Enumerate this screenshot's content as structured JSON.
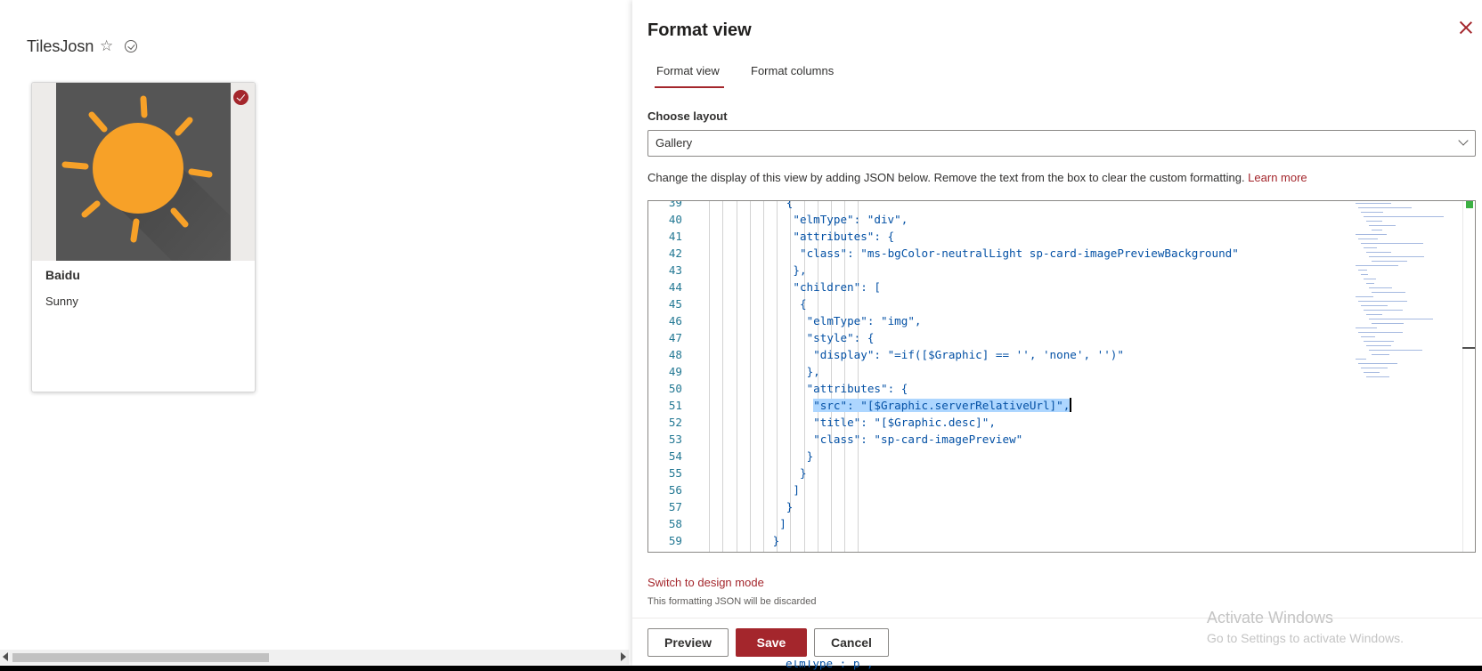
{
  "list": {
    "title": "TilesJosn",
    "star_glyph": "☆",
    "card": {
      "title": "Baidu",
      "subtitle": "Sunny",
      "check_color": "#a4262c"
    }
  },
  "panel": {
    "title": "Format view",
    "tabs": [
      {
        "label": "Format view",
        "selected": true
      },
      {
        "label": "Format columns",
        "selected": false
      }
    ],
    "layout_label": "Choose layout",
    "layout_value": "Gallery",
    "description": "Change the display of this view by adding JSON below. Remove the text from the box to clear the custom formatting. ",
    "learn_more": "Learn more",
    "switch_link": "Switch to design mode",
    "discard_note": "This formatting JSON will be discarded",
    "buttons": {
      "preview": "Preview",
      "save": "Save",
      "cancel": "Cancel"
    },
    "accent_color": "#a4262c"
  },
  "editor": {
    "lines": [
      {
        "no": "39",
        "indent": 13,
        "code": "{"
      },
      {
        "no": "40",
        "indent": 14,
        "code": "\"elmType\": \"div\","
      },
      {
        "no": "41",
        "indent": 14,
        "code": "\"attributes\": {"
      },
      {
        "no": "42",
        "indent": 15,
        "code": "\"class\": \"ms-bgColor-neutralLight sp-card-imagePreviewBackground\""
      },
      {
        "no": "43",
        "indent": 14,
        "code": "},"
      },
      {
        "no": "44",
        "indent": 14,
        "code": "\"children\": ["
      },
      {
        "no": "45",
        "indent": 15,
        "code": "{"
      },
      {
        "no": "46",
        "indent": 16,
        "code": "\"elmType\": \"img\","
      },
      {
        "no": "47",
        "indent": 16,
        "code": "\"style\": {"
      },
      {
        "no": "48",
        "indent": 17,
        "code": "\"display\": \"=if([$Graphic] == '', 'none', '')\""
      },
      {
        "no": "49",
        "indent": 16,
        "code": "},"
      },
      {
        "no": "50",
        "indent": 16,
        "code": "\"attributes\": {"
      },
      {
        "no": "51",
        "indent": 17,
        "code": "\"src\": \"[$Graphic.serverRelativeUrl]\",",
        "selected": true
      },
      {
        "no": "52",
        "indent": 17,
        "code": "\"title\": \"[$Graphic.desc]\","
      },
      {
        "no": "53",
        "indent": 17,
        "code": "\"class\": \"sp-card-imagePreview\""
      },
      {
        "no": "54",
        "indent": 16,
        "code": "}"
      },
      {
        "no": "55",
        "indent": 15,
        "code": "}"
      },
      {
        "no": "56",
        "indent": 14,
        "code": "]"
      },
      {
        "no": "57",
        "indent": 13,
        "code": "}"
      },
      {
        "no": "58",
        "indent": 12,
        "code": "]"
      },
      {
        "no": "59",
        "indent": 11,
        "code": "}"
      }
    ],
    "below_text": "elmType : p ,"
  },
  "watermark": {
    "title": "Activate Windows",
    "subtitle": "Go to Settings to activate Windows."
  }
}
